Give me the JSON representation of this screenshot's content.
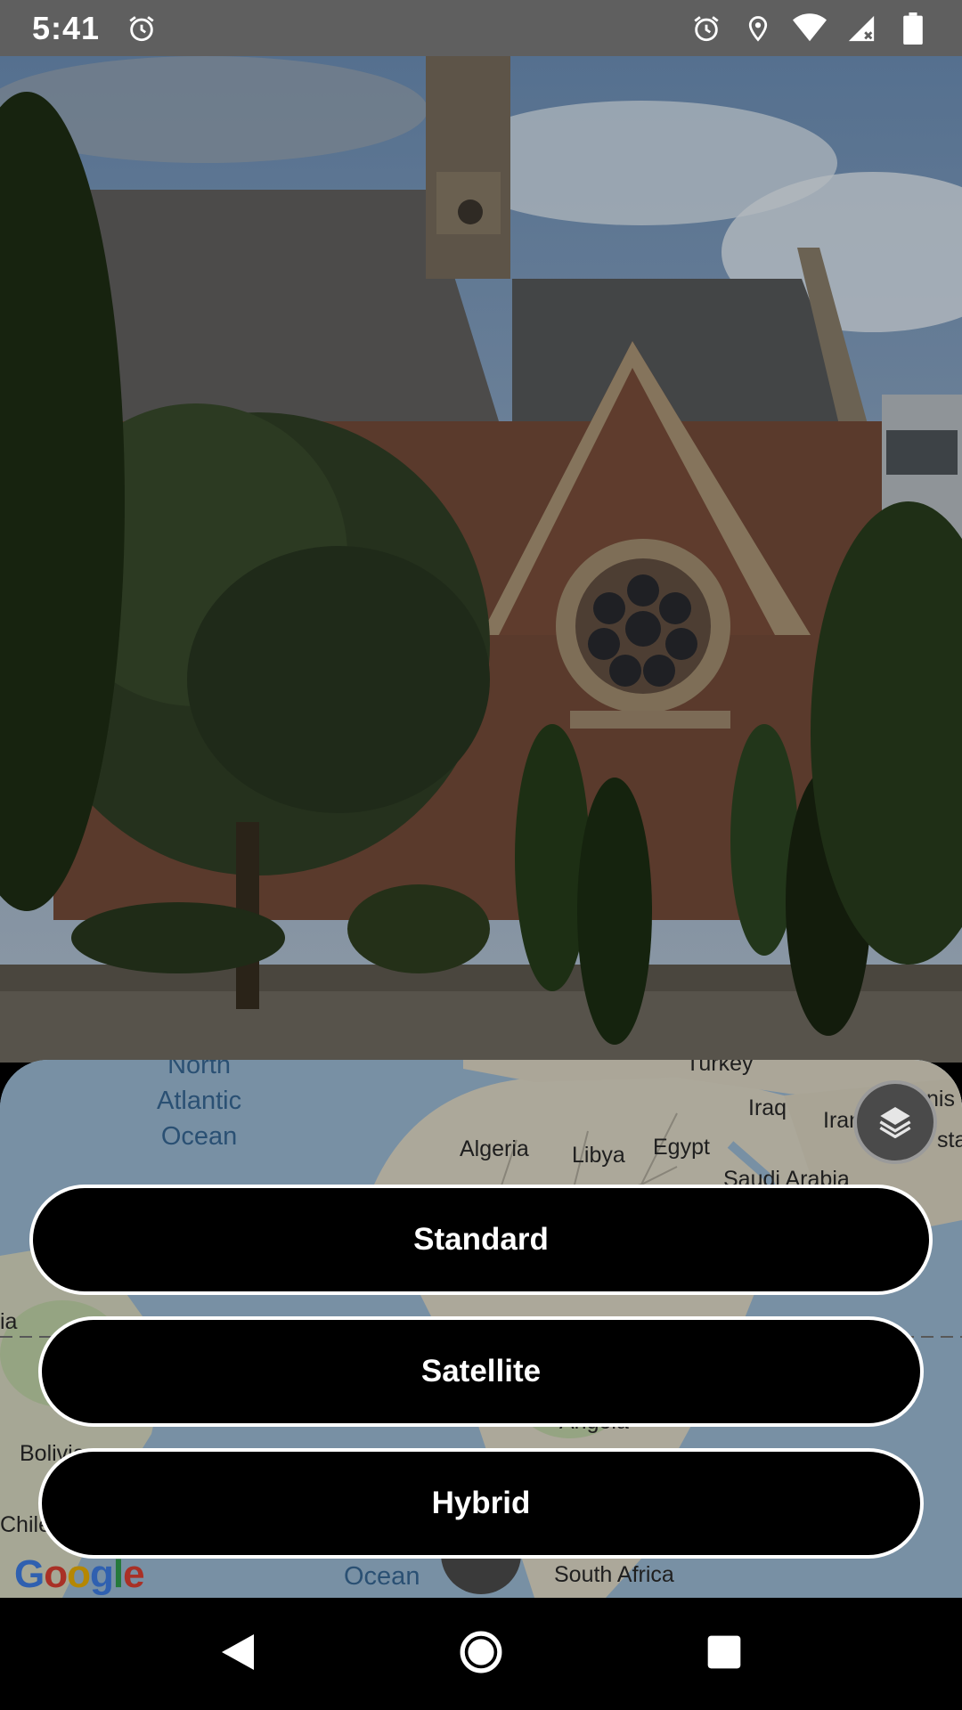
{
  "status_bar": {
    "time": "5:41",
    "icons": [
      "alarm-icon",
      "alarm-icon",
      "location-icon",
      "wifi-icon",
      "signal-icon",
      "battery-icon"
    ]
  },
  "map": {
    "country_labels": [
      "Algeria",
      "Libya",
      "Egypt",
      "Iraq",
      "Iran",
      "Saudi Arabia",
      "Turkey",
      "Bolivia",
      "Chile",
      "Angola",
      "South Africa",
      "ia",
      "nis",
      "sta"
    ],
    "ocean_labels": {
      "north_atlantic": "North\nAtlantic\nOcean",
      "south_ocean": "Ocean"
    },
    "logo": "Google",
    "layers_icon": "layers-icon"
  },
  "buttons": {
    "standard": "Standard",
    "satellite": "Satellite",
    "hybrid": "Hybrid"
  },
  "nav": [
    "back-icon",
    "home-icon",
    "recents-icon"
  ],
  "colors": {
    "status_bar": "#5f5f5f",
    "button_bg": "#000000",
    "button_border": "#ffffff",
    "water": "#8fb4d3",
    "land": "#e8e2cf"
  }
}
